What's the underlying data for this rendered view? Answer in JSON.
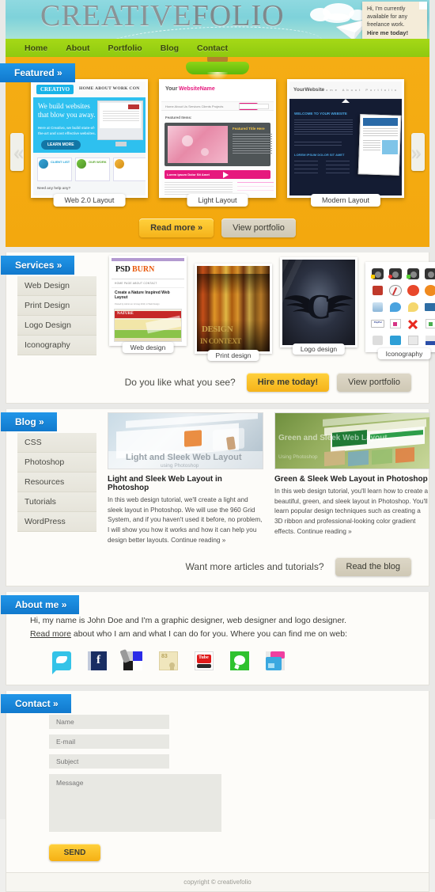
{
  "site": {
    "logo_part1": "CREATIVE",
    "logo_part2": "FOLIO"
  },
  "header_note": {
    "line1": "Hi, I'm currently",
    "line2": "available for any",
    "line3": "freelance work.",
    "line4": "Hire me today!"
  },
  "nav": {
    "items": [
      "Home",
      "About",
      "Portfolio",
      "Blog",
      "Contact"
    ]
  },
  "featured": {
    "tab_label": "Featured",
    "chevron": "»",
    "prev_arrow": "«",
    "next_arrow": "»",
    "slides": [
      {
        "caption": "Web 2.0 Layout",
        "headline": "We build websites that blow you away.",
        "brand": "CREATIVO",
        "menu": "HOME  ABOUT  WORK  CON",
        "cta": "LEARN MORE",
        "sub": "Here at Creativo, we build state-of-the-art and cost effective websites.",
        "box1": "CLIENT LIST",
        "box2": "OUR WORK",
        "bottom": "Need any help any?"
      },
      {
        "caption": "Light Layout",
        "brand1": "Your",
        "brand2": "WebsiteName",
        "section": "Featured Items:",
        "panel_title": "Featured Title Here",
        "tab_active": "Contact",
        "bottom": "Lorem ipsum Dolor Sit Amet"
      },
      {
        "caption": "Modern Layout",
        "brand": "YourWebsite",
        "welcome": "WELCOME TO YOUR WEBSITE",
        "lorem": "LOREM IPSUM DOLOR SIT AMET",
        "menu": [
          "Home",
          "About",
          "Portfolio"
        ]
      }
    ],
    "buttons": {
      "primary": "Read more »",
      "secondary": "View portfolio"
    }
  },
  "services": {
    "tab_label": "Services",
    "chevron": "»",
    "menu": [
      "Web Design",
      "Print Design",
      "Logo Design",
      "Iconography"
    ],
    "thumbs": [
      {
        "caption": "Web design",
        "title1": "PSD",
        "title2": "BURN",
        "nav": "HOME PAGE      ABOUT      CONTACT",
        "heading": "Create a Nature Inspired Web Layout",
        "byline": "Posted by Admin on 12 Aug 2010, in Web Design",
        "banner": "NATURE"
      },
      {
        "caption": "Print design",
        "text1": "DESIGN",
        "text2": "IN CONTEXT"
      },
      {
        "caption": "Logo design",
        "mark": "C"
      },
      {
        "caption": "Iconography"
      }
    ],
    "cta_question": "Do you like what you see?",
    "cta_primary": "Hire me today!",
    "cta_secondary": "View portfolio"
  },
  "blog": {
    "tab_label": "Blog",
    "chevron": "»",
    "menu": [
      "CSS",
      "Photoshop",
      "Resources",
      "Tutorials",
      "WordPress"
    ],
    "posts": [
      {
        "thumb_title": "Light and Sleek Web Layout",
        "thumb_sub": "using Photoshop",
        "title": "Light and Sleek Web Layout in Photoshop",
        "body": "In this web design tutorial, we'll create a light and sleek layout in Photoshop. We will use the 960 Grid System, and if you haven't used it before, no problem, I will show you how it works and how it can help you design better layouts. Continue reading »"
      },
      {
        "thumb_title": "Green and Sleek Web Layout",
        "thumb_sub": "Using Photoshop",
        "title": "Green & Sleek Web Layout in Photoshop",
        "body": "In this web design tutorial, you'll learn how to create a beautiful, green, and sleek layout in Photoshop. You'll learn popular design techniques such as creating a 3D ribbon and professional-looking color gradient effects. Continue reading »"
      }
    ],
    "cta_question": "Want more articles and tutorials?",
    "cta_button": "Read the blog"
  },
  "about": {
    "tab_label": "About me",
    "chevron": "»",
    "line1_pre": "Hi, my name is John Doe and I'm a graphic designer, web designer and logo designer.",
    "link": "Read more",
    "line2_post": " about who I am and what I can do for you. Where you can find me on web:",
    "social_icons": [
      "twitter-icon",
      "facebook-icon",
      "flickr-icon",
      "delicious-icon",
      "youtube-icon",
      "messenger-icon",
      "picasa-icon"
    ]
  },
  "contact": {
    "tab_label": "Contact",
    "chevron": "»",
    "fields": [
      {
        "name": "name-field",
        "placeholder": "Name"
      },
      {
        "name": "email-field",
        "placeholder": "E-mail"
      },
      {
        "name": "subject-field",
        "placeholder": "Subject"
      }
    ],
    "message_placeholder": "Message",
    "send_label": "SEND"
  },
  "footer": {
    "copyright": "copyright © creativefolio"
  },
  "colors": {
    "accent_blue": "#1179cd",
    "nav_green": "#a5d916",
    "featured_orange": "#f3a80e",
    "header_cyan": "#7ed2da",
    "button_yellow": "#f5b31a"
  }
}
